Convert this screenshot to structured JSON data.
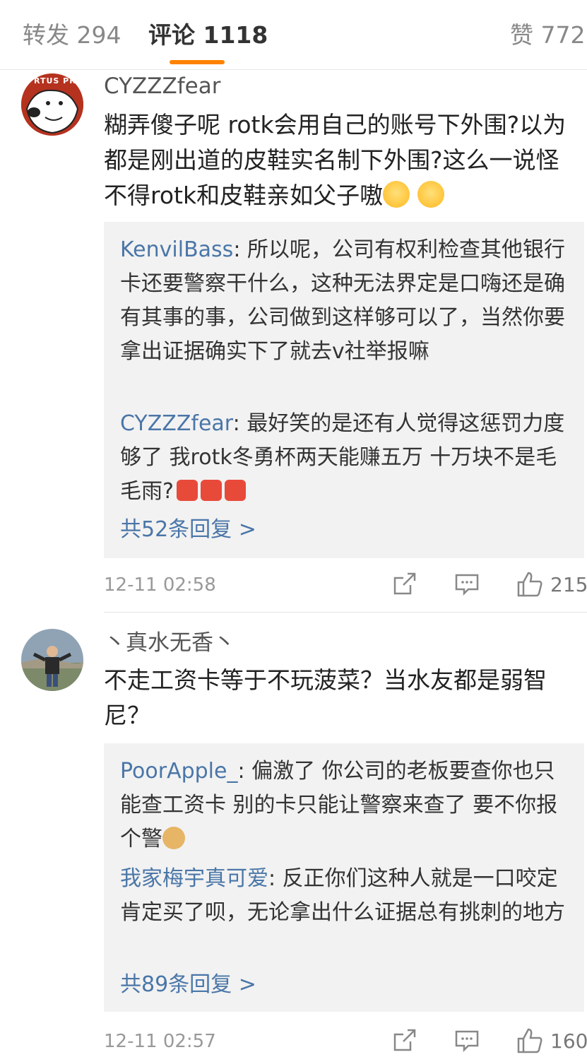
{
  "tabs": {
    "repost": "转发 294",
    "comments": "评论 1118",
    "likes": "赞 772"
  },
  "comments": [
    {
      "username": "CYZZZfear",
      "avatar_text": "RTUS PR",
      "text": "糊弄傻子呢  rotk会用自己的账号下外围?以为都是刚出道的皮鞋实名制下外围?这么一说怪不得rotk和皮鞋亲如父子嗷",
      "emojis": [
        "hug-emoji",
        "hug-emoji"
      ],
      "replies": [
        {
          "name": "KenvilBass",
          "text": "所以呢，公司有权利检查其他银行卡还要警察干什么，这种无法界定是口嗨还是确有其事的事，公司做到这样够可以了，当然你要拿出证据确实下了就去v社举报嘛"
        },
        {
          "name": "CYZZZfear",
          "text": "最好笑的是还有人觉得这惩罚力度够了 我rotk冬勇杯两天能赚五万   十万块不是毛毛雨?"
        }
      ],
      "more_replies": "共52条回复 >",
      "time": "12-11 02:58",
      "likes": "215"
    },
    {
      "username": "丶真水无香丶",
      "text": "不走工资卡等于不玩菠菜？当水友都是弱智尼？",
      "replies": [
        {
          "name": "PoorApple_",
          "text": "偏激了 你公司的老板要查你也只能查工资卡 别的卡只能让警察来查了 要不你报个警"
        },
        {
          "name": "我家梅宇真可爱",
          "text": "反正你们这种人就是一口咬定肯定买了呗，无论拿出什么证据总有挑刺的地方"
        }
      ],
      "more_replies": "共89条回复 >",
      "time": "12-11 02:57",
      "likes": "160"
    }
  ]
}
